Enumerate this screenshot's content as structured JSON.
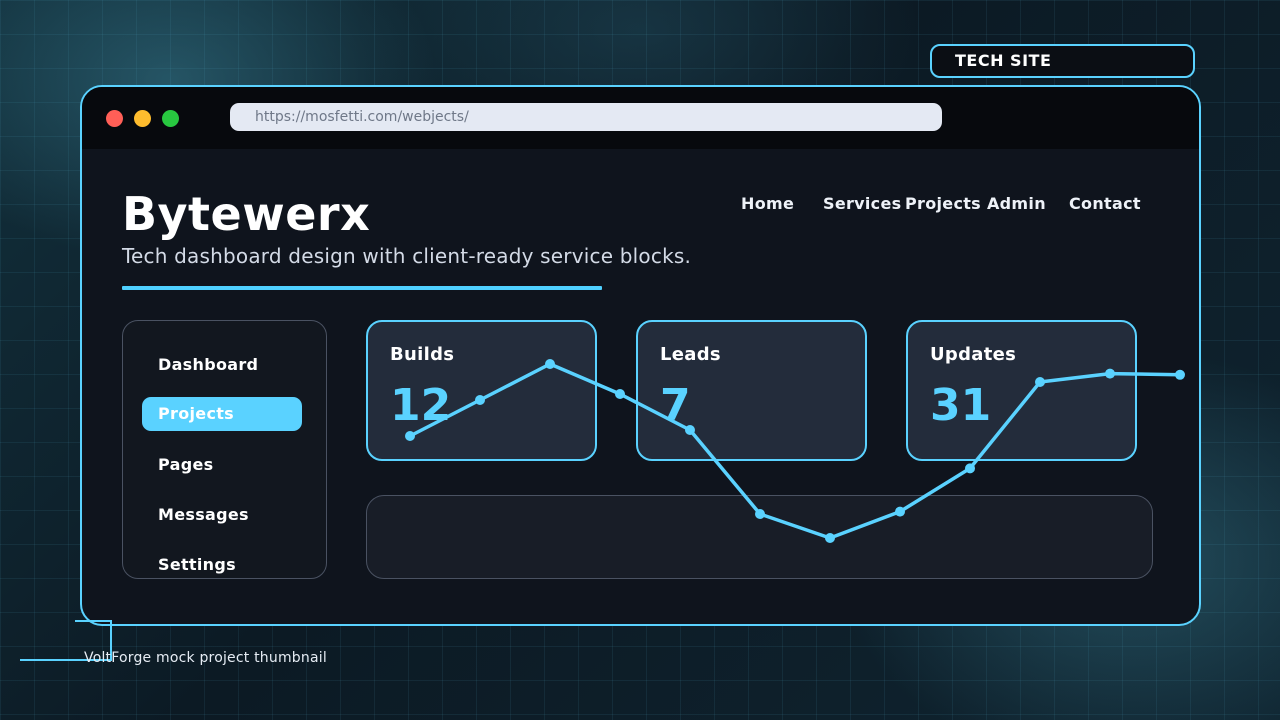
{
  "tag": {
    "label": "TECH SITE"
  },
  "browser": {
    "url": "https://mosfetti.com/webjects/"
  },
  "header": {
    "brand": "Bytewerx",
    "tagline": "Tech dashboard design with client-ready service blocks."
  },
  "nav": [
    "Home",
    "Services",
    "Projects",
    "Admin",
    "Contact"
  ],
  "sidebar": {
    "items": [
      {
        "label": "Dashboard",
        "active": false
      },
      {
        "label": "Projects",
        "active": true
      },
      {
        "label": "Pages",
        "active": false
      },
      {
        "label": "Messages",
        "active": false
      },
      {
        "label": "Settings",
        "active": false
      }
    ]
  },
  "stats": [
    {
      "label": "Builds",
      "value": "12"
    },
    {
      "label": "Leads",
      "value": "7"
    },
    {
      "label": "Updates",
      "value": "31"
    }
  ],
  "colors": {
    "accent": "#5ad2ff",
    "panel": "#0f141d",
    "card": "#232c3b"
  },
  "chart_data": {
    "type": "line",
    "values": [
      12,
      15,
      18,
      15.5,
      12.5,
      5.5,
      3.5,
      5.7,
      9.3,
      16.5,
      17.2,
      17.1
    ],
    "ylim": [
      0,
      20
    ]
  },
  "caption": "VoltForge mock project thumbnail"
}
